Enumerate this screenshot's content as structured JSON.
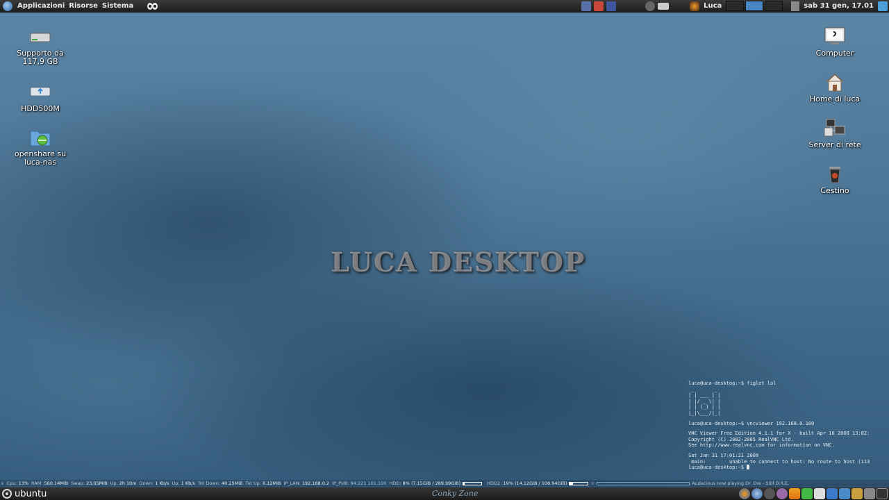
{
  "top_panel": {
    "menus": [
      "Applicazioni",
      "Risorse",
      "Sistema"
    ],
    "user": "Luca",
    "clock": "sab 31 gen, 17.01"
  },
  "desktop_icons_left": [
    {
      "label": "Supporto da\n117,9 GB",
      "icon": "drive-icon"
    },
    {
      "label": "HDD500M",
      "icon": "usb-drive-icon"
    },
    {
      "label": "openshare su\nluca-nas",
      "icon": "network-folder-icon"
    }
  ],
  "desktop_icons_right": [
    {
      "label": "Computer",
      "icon": "computer-icon"
    },
    {
      "label": "Home di luca",
      "icon": "home-icon"
    },
    {
      "label": "Server di rete",
      "icon": "network-server-icon"
    },
    {
      "label": "Cestino",
      "icon": "trash-icon"
    }
  ],
  "center_logo": "LUCA DESKTOP",
  "terminal": {
    "lines": [
      "luca@uca-desktop:~$ figlet lol",
      " _       _",
      "| | ___ | |",
      "| |/ _ \\| |",
      "| | (_) | |",
      "|_|\\___/|_|",
      "",
      "luca@uca-desktop:~$ vncviewer 192.168.0.100",
      "",
      "VNC Viewer Free Edition 4.1.1 for X - built Apr 16 2008 13:02:",
      "Copyright (C) 2002-2005 RealVNC Ltd.",
      "See http://www.realvnc.com for information on VNC.",
      "",
      "Sat Jan 31 17:01:21 2009",
      " main:        unable to connect to host: No route to host (113",
      "luca@uca-desktop:~$ "
    ]
  },
  "conky": {
    "cpu_label": "Cpu:",
    "cpu": "13%",
    "ram_label": "RAM:",
    "ram": "560.14MiB",
    "swap_label": "Swap:",
    "swap": "23.05MiB",
    "up_label": "Up:",
    "uptime": "2h 10m",
    "down_label": "Down:",
    "down": "1 Kb/s",
    "upl_label": "Up:",
    "upl": "1 Kb/s",
    "totdown_label": "Tot Down:",
    "totdown": "40.25MiB",
    "totup_label": "Tot Up:",
    "totup": "6.12MiB",
    "iplan_label": "IP_LAN:",
    "iplan": "192.168.0.2",
    "ippub_label": "IP_PUB:",
    "ippub": "84.221.101.100",
    "hdd_label": "HDD:",
    "hdd": "8%",
    "hdd_detail": "(7.15GiB / 289.99GiB)",
    "hdd_fill": 0.08,
    "hdd2_label": "HDD2:",
    "hdd2": "19%",
    "hdd2_detail": "(14.12GiB / 108.94GiB)",
    "hdd2_fill": 0.19,
    "music": "Audacious now playing Dr. Dre - Still D.R.E."
  },
  "bottom_panel": {
    "ubuntu_label": "ubuntu",
    "conky_zone": "Conky Zone"
  },
  "colors": {
    "desktop_blue": "#4f7797",
    "panel_dark": "#1e1e1e",
    "ip_blue": "#9ec7ee"
  }
}
